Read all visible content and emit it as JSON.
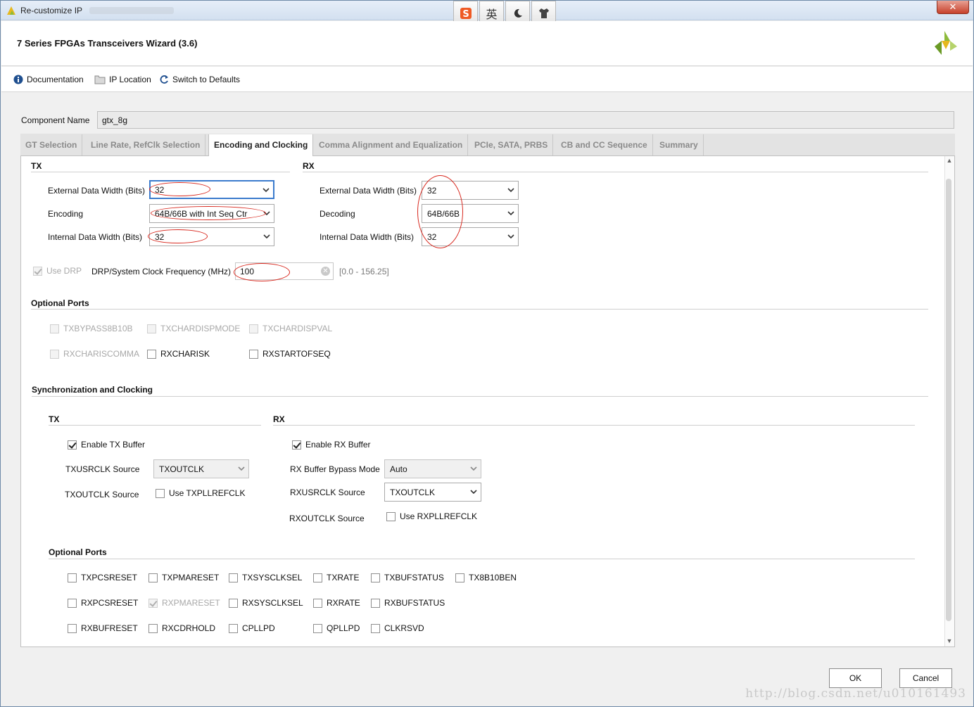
{
  "window": {
    "title": "Re-customize IP",
    "close_label": "✕"
  },
  "ime": {
    "buttons": [
      {
        "icon": "sogou-s-icon",
        "label": "S"
      },
      {
        "icon": "english-mode-icon",
        "label": "英"
      },
      {
        "icon": "moon-icon",
        "label": "☽"
      },
      {
        "icon": "tshirt-icon",
        "label": "👕"
      }
    ]
  },
  "header": {
    "title": "7 Series FPGAs Transceivers Wizard (3.6)"
  },
  "toolbar": {
    "documentation": "Documentation",
    "ip_location": "IP Location",
    "switch_defaults": "Switch to Defaults"
  },
  "component": {
    "label": "Component Name",
    "value": "gtx_8g"
  },
  "tabs": [
    "GT Selection",
    "Line Rate, RefClk Selection",
    "Encoding and Clocking",
    "Comma Alignment and Equalization",
    "PCIe, SATA, PRBS",
    "CB and CC Sequence",
    "Summary"
  ],
  "active_tab": "Encoding and Clocking",
  "tx": {
    "title": "TX",
    "ext_width_label": "External Data Width (Bits)",
    "ext_width_value": "32",
    "encoding_label": "Encoding",
    "encoding_value": "64B/66B with Int Seq Ctr",
    "int_width_label": "Internal Data Width (Bits)",
    "int_width_value": "32"
  },
  "rx": {
    "title": "RX",
    "ext_width_label": "External Data Width (Bits)",
    "ext_width_value": "32",
    "decoding_label": "Decoding",
    "decoding_value": "64B/66B",
    "int_width_label": "Internal Data Width (Bits)",
    "int_width_value": "32"
  },
  "drp": {
    "use_drp_label": "Use DRP",
    "use_drp_checked": true,
    "freq_label": "DRP/System Clock Frequency (MHz)",
    "freq_value": "100",
    "range": "[0.0 - 156.25]"
  },
  "optional_ports_1": {
    "title": "Optional Ports",
    "items": [
      {
        "label": "TXBYPASS8B10B",
        "checked": false,
        "disabled": true
      },
      {
        "label": "TXCHARDISPMODE",
        "checked": false,
        "disabled": true
      },
      {
        "label": "TXCHARDISPVAL",
        "checked": false,
        "disabled": true
      },
      {
        "label": "RXCHARISCOMMA",
        "checked": false,
        "disabled": true
      },
      {
        "label": "RXCHARISK",
        "checked": false,
        "disabled": false
      },
      {
        "label": "RXSTARTOFSEQ",
        "checked": false,
        "disabled": false
      }
    ]
  },
  "sync": {
    "title": "Synchronization and Clocking",
    "tx": {
      "title": "TX",
      "enable_buffer": "Enable TX Buffer",
      "usrclk_label": "TXUSRCLK Source",
      "usrclk_value": "TXOUTCLK",
      "outclk_label": "TXOUTCLK Source",
      "use_pllrefclk": "Use TXPLLREFCLK"
    },
    "rx": {
      "title": "RX",
      "enable_buffer": "Enable RX Buffer",
      "bypass_label": "RX Buffer Bypass Mode",
      "bypass_value": "Auto",
      "usrclk_label": "RXUSRCLK Source",
      "usrclk_value": "TXOUTCLK",
      "outclk_label": "RXOUTCLK Source",
      "use_pllrefclk": "Use RXPLLREFCLK"
    }
  },
  "optional_ports_2": {
    "title": "Optional Ports",
    "rows": [
      [
        {
          "label": "TXPCSRESET",
          "checked": false,
          "disabled": false
        },
        {
          "label": "TXPMARESET",
          "checked": false,
          "disabled": false
        },
        {
          "label": "TXSYSCLKSEL",
          "checked": false,
          "disabled": false
        },
        {
          "label": "TXRATE",
          "checked": false,
          "disabled": false
        },
        {
          "label": "TXBUFSTATUS",
          "checked": false,
          "disabled": false
        },
        {
          "label": "TX8B10BEN",
          "checked": false,
          "disabled": false
        }
      ],
      [
        {
          "label": "RXPCSRESET",
          "checked": false,
          "disabled": false
        },
        {
          "label": "RXPMARESET",
          "checked": true,
          "disabled": true
        },
        {
          "label": "RXSYSCLKSEL",
          "checked": false,
          "disabled": false
        },
        {
          "label": "RXRATE",
          "checked": false,
          "disabled": false
        },
        {
          "label": "RXBUFSTATUS",
          "checked": false,
          "disabled": false
        }
      ],
      [
        {
          "label": "RXBUFRESET",
          "checked": false,
          "disabled": false
        },
        {
          "label": "RXCDRHOLD",
          "checked": false,
          "disabled": false
        },
        {
          "label": "CPLLPD",
          "checked": false,
          "disabled": false
        },
        {
          "label": "QPLLPD",
          "checked": false,
          "disabled": false
        },
        {
          "label": "CLKRSVD",
          "checked": false,
          "disabled": false
        }
      ]
    ]
  },
  "footer": {
    "ok": "OK",
    "cancel": "Cancel",
    "watermark": "http://blog.csdn.net/u010161493"
  },
  "colors": {
    "annotation": "#d8281e",
    "focus": "#3b7bcd",
    "xilinx_logo": "#8dba3a"
  }
}
